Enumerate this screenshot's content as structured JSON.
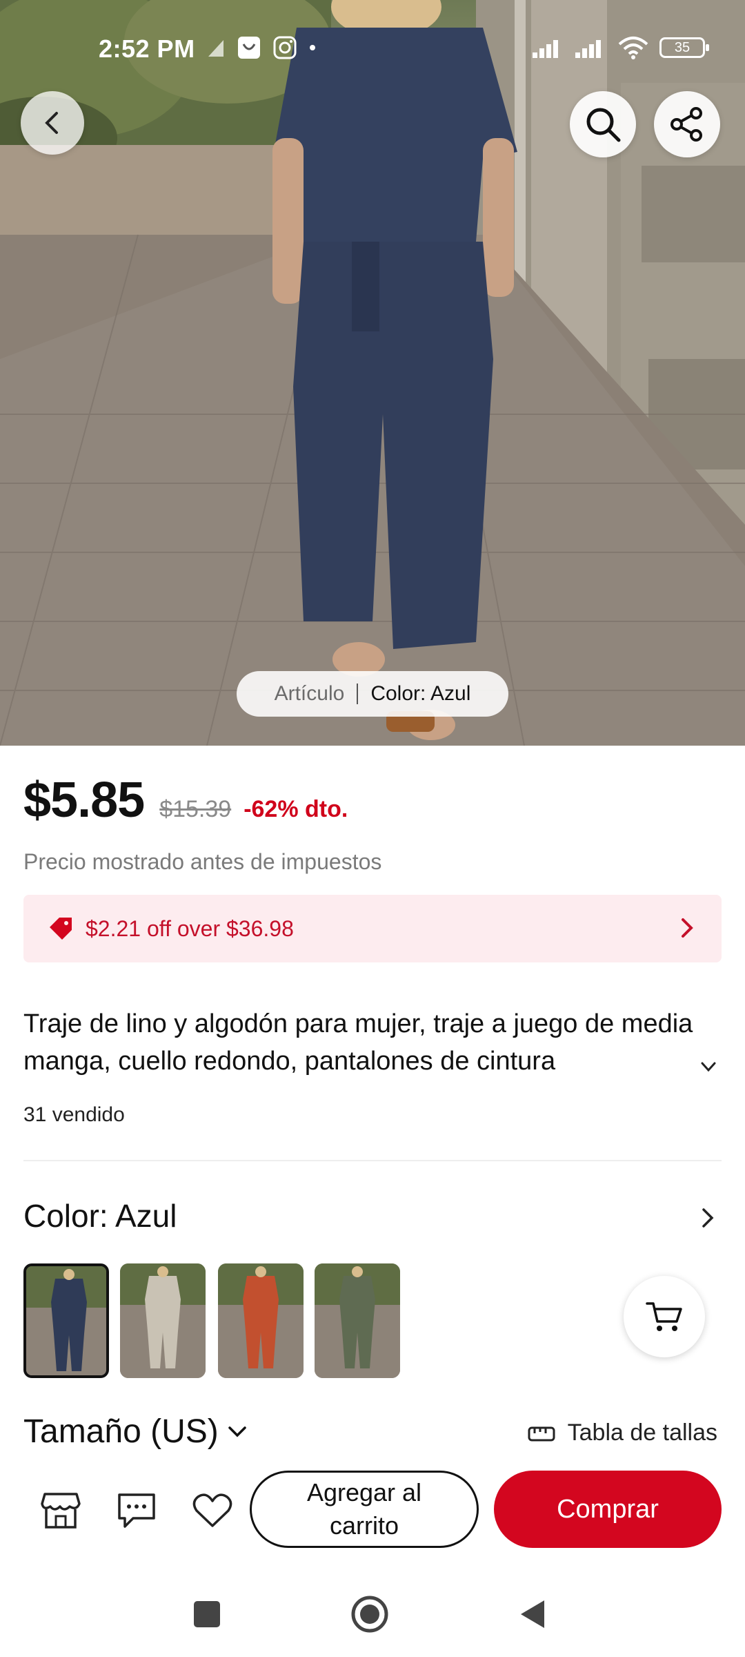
{
  "status_bar": {
    "time": "2:52 PM",
    "battery": "35"
  },
  "product_image": {
    "pill_left": "Artículo",
    "pill_right": "Color: Azul"
  },
  "pricing": {
    "price": "$5.85",
    "original_price": "$15.39",
    "discount": "-62% dto.",
    "tax_note": "Precio mostrado antes de impuestos",
    "coupon": "$2.21 off over $36.98",
    "accent_color": "#d3061f"
  },
  "product": {
    "title": "Traje de lino y algodón para mujer, traje a juego de media manga, cuello redondo, pantalones de cintura",
    "sold": "31 vendido"
  },
  "color_section": {
    "label": "Color: Azul",
    "swatches": [
      {
        "name": "navy",
        "color": "#2f3b57",
        "selected": true
      },
      {
        "name": "beige",
        "color": "#c9c2b4",
        "selected": false
      },
      {
        "name": "rust",
        "color": "#c2502f",
        "selected": false
      },
      {
        "name": "olive",
        "color": "#5f6b52",
        "selected": false
      }
    ]
  },
  "size_section": {
    "label": "Tamaño (US)",
    "size_chart": "Tabla de tallas"
  },
  "actions": {
    "add_to_cart": "Agregar al carrito",
    "buy": "Comprar"
  }
}
